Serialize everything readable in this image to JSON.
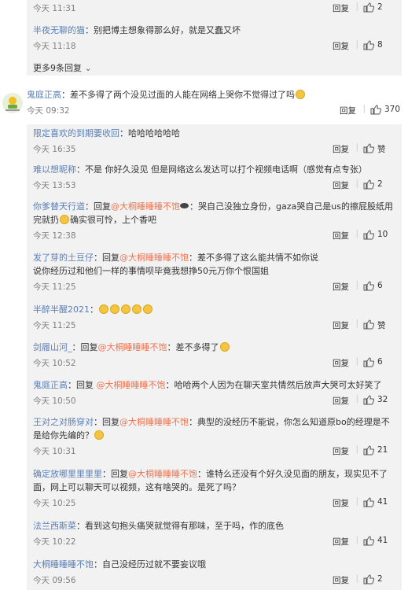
{
  "top_replies": [
    {
      "user": "",
      "text": "",
      "time": "今天 11:31",
      "reply": "回复",
      "likes": "2"
    },
    {
      "user": "半夜无聊的猫",
      "text": "：别把博主想象得那么好，就是又蠢又坏",
      "time": "今天 11:18",
      "reply": "回复",
      "likes": "8"
    }
  ],
  "more_replies": "更多9条回复",
  "main_comment": {
    "user": "鬼庭正高",
    "text": "：差不多得了两个没见过面的人能在网络上哭你不觉得过了吗",
    "time": "今天 09:32",
    "reply": "回复",
    "likes": "370"
  },
  "replies": [
    {
      "user": "限定喜欢的到期要收回",
      "text": "：哈哈哈哈哈哈",
      "time": "今天 16:35",
      "reply": "回复",
      "likes": "赞"
    },
    {
      "user": "难以想昵称",
      "text": "：不是 你好久没见 但是网络这么发达可以打个视频电话啊（感觉有点专张）",
      "time": "今天 13:53",
      "reply": "回复",
      "likes": "2"
    },
    {
      "user": "你爹替天行道",
      "text_a": "：回复",
      "mention": "@大桐睡睡睡不饱",
      "text_b": "：哭自己没独立身份，gaza哭自己是us的擦屁股纸用",
      "text_c": "完就扔",
      "text_d": "确实很可怜，上个香吧",
      "time": "今天 12:38",
      "reply": "回复",
      "likes": "10"
    },
    {
      "user": "发了芽的土豆仔",
      "text_a": "：回复",
      "mention": "@大桐睡睡睡不饱",
      "text_b": "：差不多得了这么能共情不如你说",
      "text_c": "说你经历过和他们一样的事情呗毕竟我想挣50元万你个恨国姐",
      "time": "今天 11:25",
      "reply": "回复",
      "likes": "6"
    },
    {
      "user": "半醉半醒2021",
      "text": "：",
      "time": "今天 11:25",
      "reply": "回复",
      "likes": "赞"
    },
    {
      "user": "剑履山河_",
      "text_a": "：回复",
      "mention": "@大桐睡睡睡不饱",
      "text_b": "：差不多得了",
      "time": "今天 10:52",
      "reply": "回复",
      "likes": "6"
    },
    {
      "user": "鬼庭正高",
      "text_a": "：回复 ",
      "mention": "@大桐睡睡睡不饱",
      "text_b": "：哈哈两个人因为在聊天室共情然后放声大哭可太好笑了",
      "time": "今天 10:50",
      "reply": "回复",
      "likes": "32"
    },
    {
      "user": "王对之对肠穿对",
      "text_a": "：回复",
      "mention": "@大桐睡睡睡不饱",
      "text_b": "：典型的没经历不能说，你怎么知道原bo的经理是不",
      "text_c": "是给你先编的？",
      "time": "今天 10:31",
      "reply": "回复",
      "likes": "21"
    },
    {
      "user": "确定放哪里里里里",
      "text_a": "：回复",
      "mention": "@大桐睡睡睡不饱",
      "text_b": "：谁特么还没有个好久没见面的朋友，现实见不了",
      "text_c": "面，网上可以聊天可以视频，这有啥哭的。是死了吗？",
      "time": "今天 10:25",
      "reply": "回复",
      "likes": "41"
    },
    {
      "user": "法兰西斯菜",
      "text": "：看到这句抱头痛哭就觉得有那味，至于吗，作的底色",
      "time": "今天 10:22",
      "reply": "回复",
      "likes": "41"
    },
    {
      "user": "大桐睡睡睡不饱",
      "text": "：自己没经历过就不要妄议哦",
      "time": "今天 09:56",
      "reply": "回复",
      "likes": "2"
    }
  ],
  "colors": {
    "username": "#eb7350",
    "nested_bg": "#f2f2f2",
    "time": "#808080"
  }
}
